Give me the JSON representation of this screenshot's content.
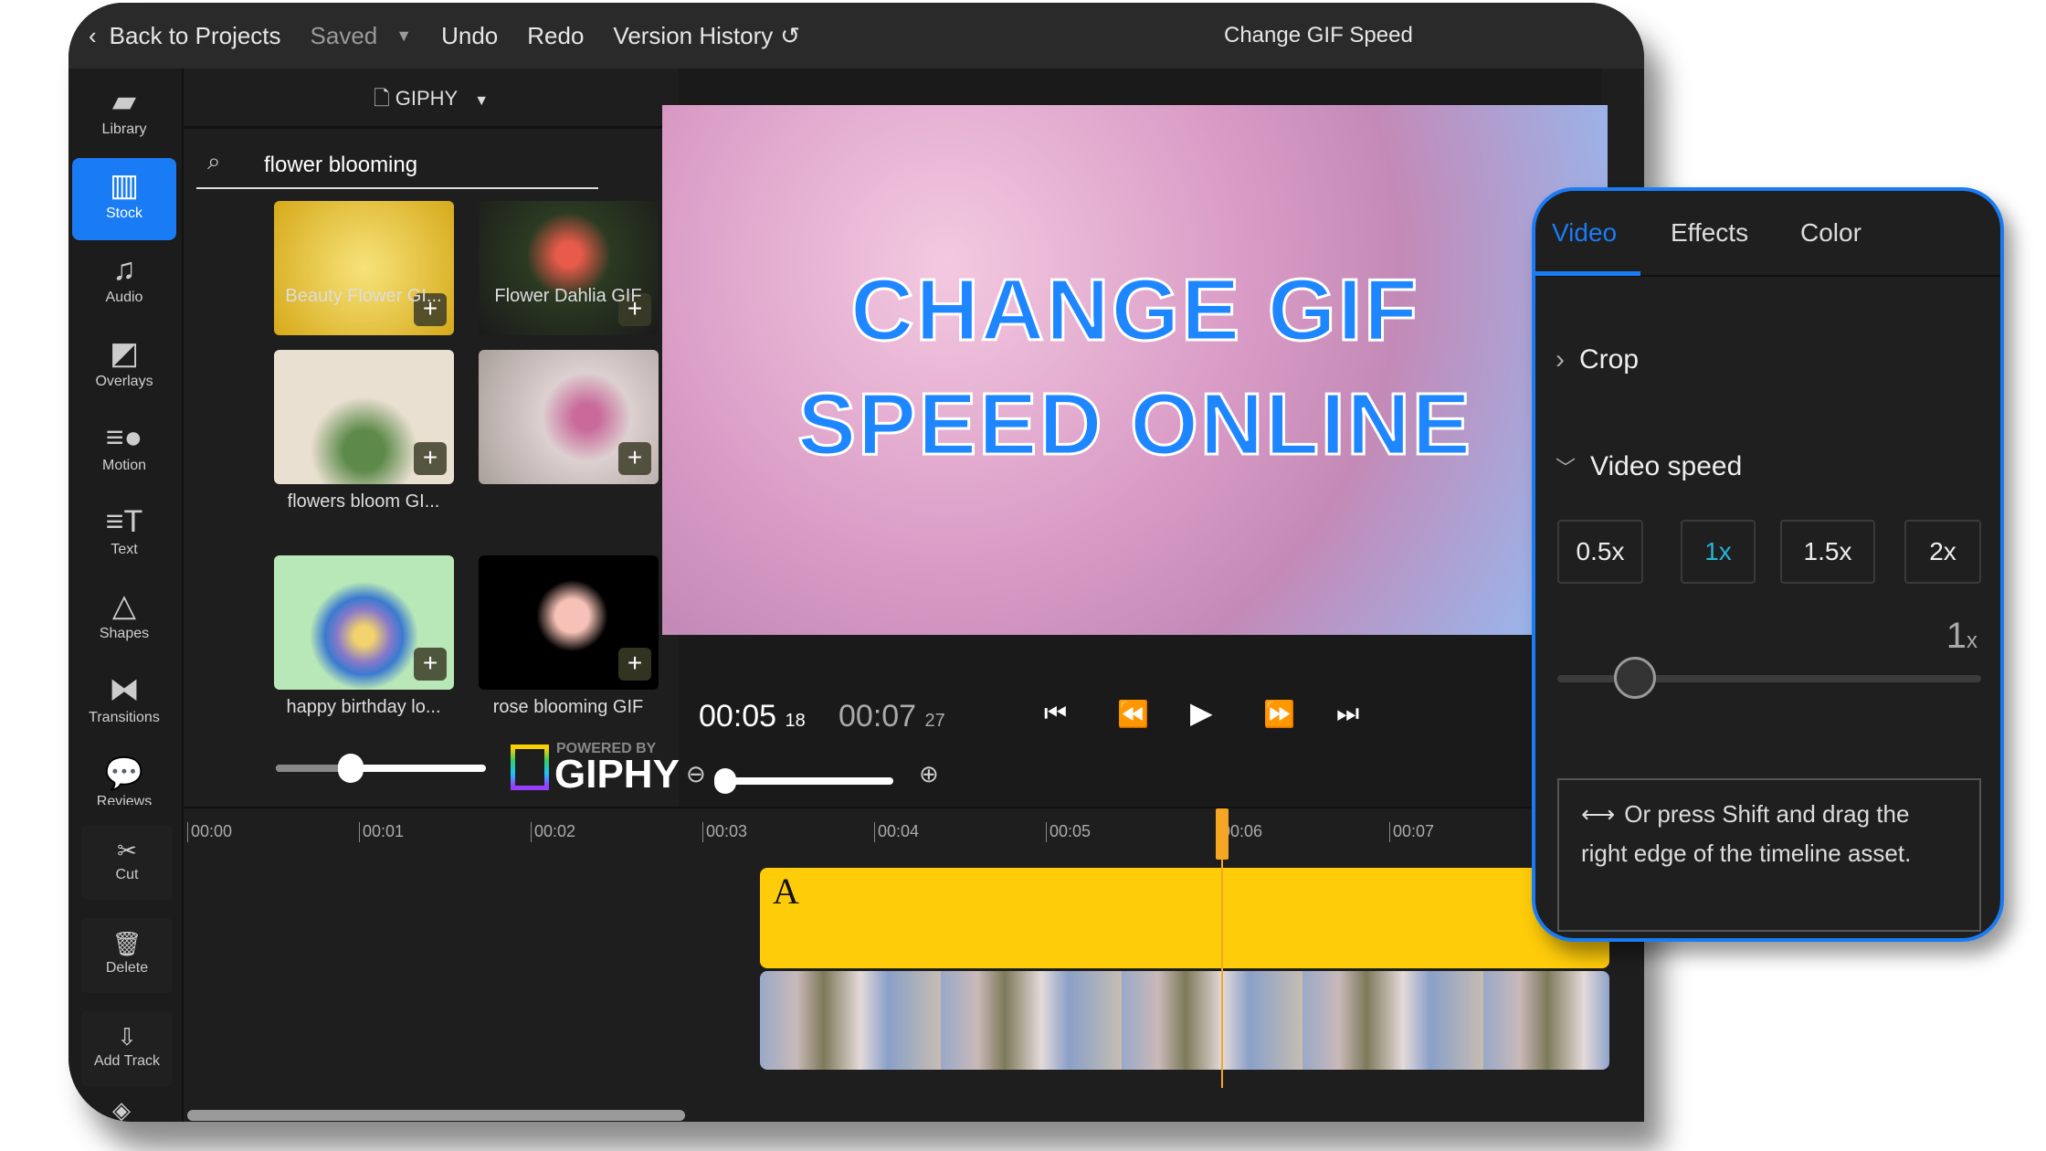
{
  "topbar": {
    "back": "Back to Projects",
    "saved": "Saved",
    "undo": "Undo",
    "redo": "Redo",
    "history": "Version History",
    "title": "Change GIF Speed"
  },
  "rail": [
    {
      "label": "Library",
      "icon": "folder-icon"
    },
    {
      "label": "Stock",
      "icon": "stock-icon",
      "active": true
    },
    {
      "label": "Audio",
      "icon": "music-icon"
    },
    {
      "label": "Overlays",
      "icon": "overlay-icon"
    },
    {
      "label": "Motion",
      "icon": "motion-icon"
    },
    {
      "label": "Text",
      "icon": "text-icon"
    },
    {
      "label": "Shapes",
      "icon": "shapes-icon"
    },
    {
      "label": "Transitions",
      "icon": "transitions-icon"
    },
    {
      "label": "Reviews",
      "icon": "chat-icon"
    }
  ],
  "media": {
    "source": "GIPHY",
    "search": "flower blooming",
    "powered_by": "POWERED BY",
    "brand": "GIPHY",
    "items": [
      {
        "label": "Beauty Flower GI..."
      },
      {
        "label": "Flower Dahlia GIF"
      },
      {
        "label": "flowers bloom GI..."
      },
      {
        "label": "",
        "label_hidden": true
      },
      {
        "label": "happy birthday lo..."
      },
      {
        "label": "rose blooming GIF"
      }
    ]
  },
  "preview": {
    "line1": "CHANGE GIF",
    "line2": "SPEED ONLINE",
    "current": "00:05",
    "current_frames": "18",
    "total": "00:07",
    "total_frames": "27",
    "zoom": "105"
  },
  "timeline": {
    "ticks": [
      "00:00",
      "00:01",
      "00:02",
      "00:03",
      "00:04",
      "00:05",
      "00:06",
      "00:07"
    ],
    "text_clip": "A",
    "tools": [
      "Cut",
      "Delete",
      "Add Track"
    ],
    "playhead": "00:05.18"
  },
  "panel": {
    "tabs": [
      "Video",
      "Effects",
      "Color"
    ],
    "active_tab": "Video",
    "crop": "Crop",
    "speed_title": "Video speed",
    "speeds": [
      "0.5x",
      "1x",
      "1.5x",
      "2x"
    ],
    "selected_speed": "1x",
    "slider_value": "1",
    "slider_unit": "x",
    "hint": "Or press Shift and drag the right edge of the timeline asset."
  },
  "colors": {
    "accent": "#1a7cf5",
    "clip": "#ffcc0a",
    "playhead": "#f5a623",
    "selected": "#27b4d6"
  }
}
